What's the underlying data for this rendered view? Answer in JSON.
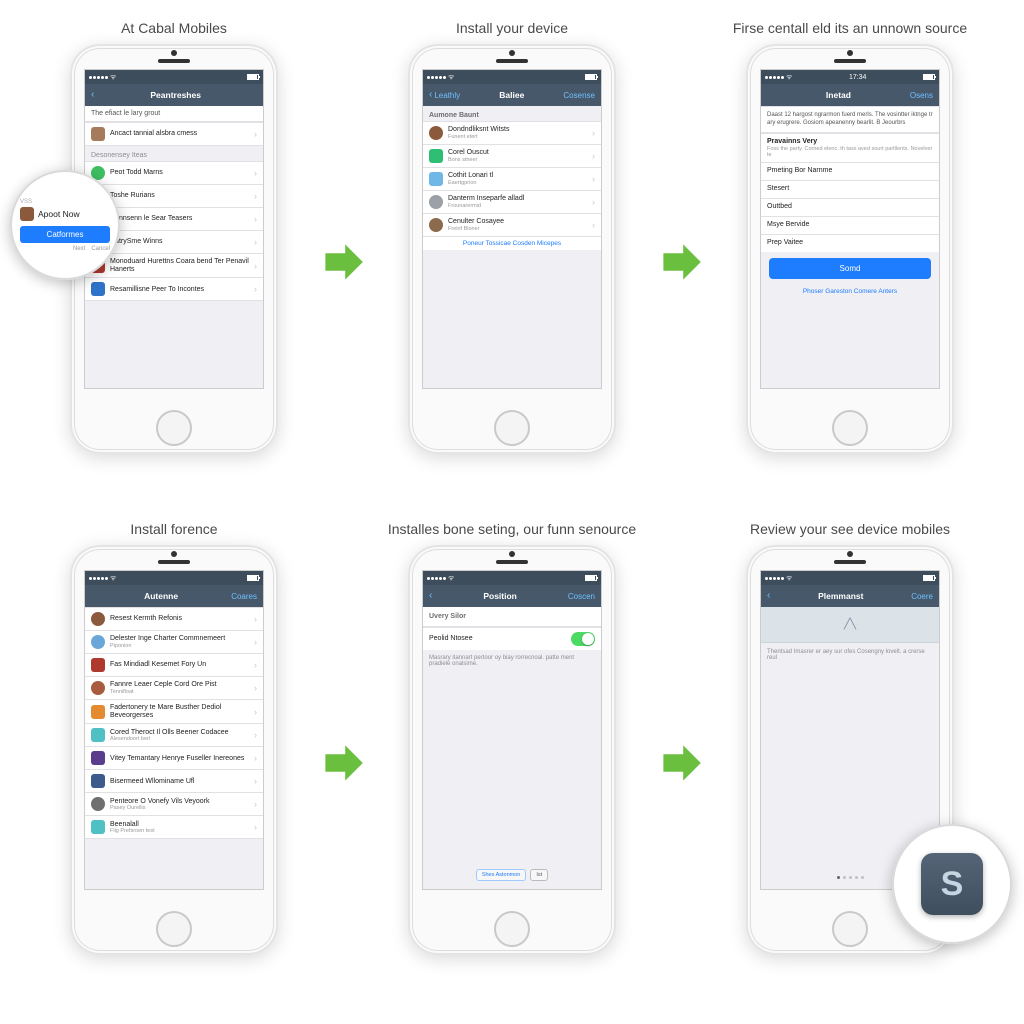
{
  "steps": [
    {
      "caption": "At Cabal Mobiles",
      "nav": {
        "back": "",
        "title": "Peantreshes",
        "right": ""
      },
      "sub_head": "The efiact le lary grout",
      "magnify": {
        "tiny": "VSS",
        "label": "Apoot Now",
        "button": "Catformes",
        "foot_a": "Next",
        "foot_b": "Cancel"
      },
      "section_title": "Desonensey Iteas",
      "rows": [
        {
          "icon": "#3fbf63",
          "round": true,
          "label": "Peot Todd Marns"
        },
        {
          "icon": "#d36ba5",
          "label": "Toshe Rurians"
        },
        {
          "icon": "#6f6f6f",
          "label": "Ronnsenn le Sear Teasers"
        },
        {
          "icon": "#4a4a4a",
          "label": "HatrySme Winns"
        },
        {
          "icon": "#b0392e",
          "label": "Monoduard Hurettns Coara bend Ter Penavil Hanerts"
        },
        {
          "icon": "#2f72c9",
          "label": "Resamillisne Peer To Incontes"
        }
      ]
    },
    {
      "caption": "Install your device",
      "nav": {
        "back": "Leathly",
        "title": "Baliee",
        "right": "Cosense"
      },
      "section_title": "Aumone Baunt",
      "rows": [
        {
          "icon": "#8b5a3c",
          "round": true,
          "label": "Dondndliksnt Witsts",
          "sub": "Funent etert"
        },
        {
          "icon": "#2fbf74",
          "label": "Corel Ouscut",
          "sub": "Bons stneer"
        },
        {
          "icon": "#6fb7e6",
          "label": "Cothit Lonari tl",
          "sub": "Eaertgprion"
        },
        {
          "icon": "#9aa0a6",
          "round": true,
          "label": "Danterm Inseparfe alladl",
          "sub": "Frounarermid"
        },
        {
          "icon": "#8c6a4d",
          "round": true,
          "label": "Cenulter Cosayee",
          "sub": "Freinf Bloner"
        }
      ],
      "footer_link": "Poneur Tossicae Cosden Micepes"
    },
    {
      "caption": "Firse centall eld its an unnown source",
      "nav": {
        "back": "",
        "title": "Inetad",
        "right": "Osens"
      },
      "time": "17:34",
      "info_text": "Daast 12 hargost ngrarmon fuerd merls. The vosintter iktnge tr ary erugrere. Gosiom apeanenny bearlit. B Jeourbrs",
      "rows": [
        {
          "label": "Pravainns Very",
          "sub": "Foss the party. Corned elenc. th tass aved sourt partllents. Novelver te"
        },
        {
          "label": "Pmeting Bor Narnme"
        },
        {
          "label": "Stesert"
        },
        {
          "label": "Outtbed"
        },
        {
          "label": "Msye Bervide"
        },
        {
          "label": "Prep Vaitee"
        }
      ],
      "button": "Somd",
      "footer_link": "Phoser Gareston Comere Anters"
    },
    {
      "caption": "Install forence",
      "nav": {
        "back": "",
        "title": "Autenne",
        "right": "Coares"
      },
      "rows": [
        {
          "icon": "#8b5a3c",
          "round": true,
          "label": "Resest Kermth Refonis"
        },
        {
          "icon": "#6aa7d8",
          "round": true,
          "label": "Delester Inge Charter Commnemeert",
          "sub": "Piponion"
        },
        {
          "icon": "#b0392e",
          "label": "Fas Mindiadl Kesemet Fory Un"
        },
        {
          "icon": "#a85b3d",
          "round": true,
          "label": "Fannre Leaer Ceple Cord Ore Pist",
          "sub": "Tennifloat"
        },
        {
          "icon": "#e38b2f",
          "label": "Fadertonery te Mare Busther Dediol Beveorgerses"
        },
        {
          "icon": "#4fc0c4",
          "label": "Cored Theroct Il Olls Beener Codacee",
          "sub": "Alesendoort berl"
        },
        {
          "icon": "#5a3d8c",
          "label": "Vitey Temantary Henrye Fuseller Inereones"
        },
        {
          "icon": "#3d5a8c",
          "label": "Bisermeed Wllominame Ufl"
        },
        {
          "icon": "#6f6f6f",
          "round": true,
          "label": "Penteore O Vonefy Vils Veyoork",
          "sub": "Pasey Ourellis"
        },
        {
          "icon": "#4fc0c4",
          "label": "Beenalall",
          "sub": "Flig Prefsroen test"
        }
      ]
    },
    {
      "caption": "Installes bone seting, our funn senource",
      "nav": {
        "back": "",
        "title": "Position",
        "right": "Coscen"
      },
      "section_title": "Uvery Silor",
      "toggle_row": {
        "label": "Peolid Ntosee"
      },
      "desc_text": "Masrary itannart pertoor oy biay rorrecnoal. patte ment pradiele onalsime.",
      "seg_a": "Shes Astonmon",
      "seg_b": "Ist"
    },
    {
      "caption": "Review your see device mobiles",
      "nav": {
        "back": "",
        "title": "Plemmanst",
        "right": "Coere"
      },
      "banner_text": "",
      "desc_text": "Thentsad Imasrer er aey sur ofes Cosengny lovelt. a crerse reul",
      "magnify_icon": "S"
    }
  ],
  "colors": {
    "accent": "#1e7cff",
    "nav": "#47586a",
    "arrow": "#6abf3f"
  }
}
